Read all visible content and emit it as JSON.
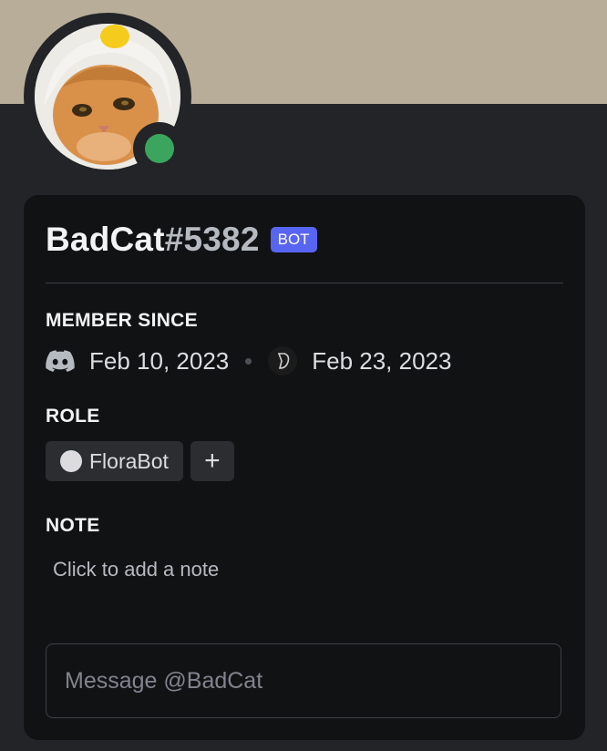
{
  "profile": {
    "username": "BadCat",
    "discriminator": "#5382",
    "badge": "BOT",
    "avatar_icon": "cat-avatar",
    "status": "online",
    "banner_color": "#b8ad99",
    "status_color": "#3ba55d"
  },
  "member_since": {
    "title": "MEMBER SINCE",
    "discord_icon": "discord-icon",
    "discord_date": "Feb 10, 2023",
    "server_icon": "server-icon",
    "server_date": "Feb 23, 2023"
  },
  "role": {
    "title": "ROLE",
    "roles": [
      {
        "name": "FloraBot",
        "color": "#dcdcdf"
      }
    ],
    "add_label": "+"
  },
  "note": {
    "title": "NOTE",
    "placeholder": "Click to add a note"
  },
  "message": {
    "placeholder": "Message @BadCat"
  }
}
